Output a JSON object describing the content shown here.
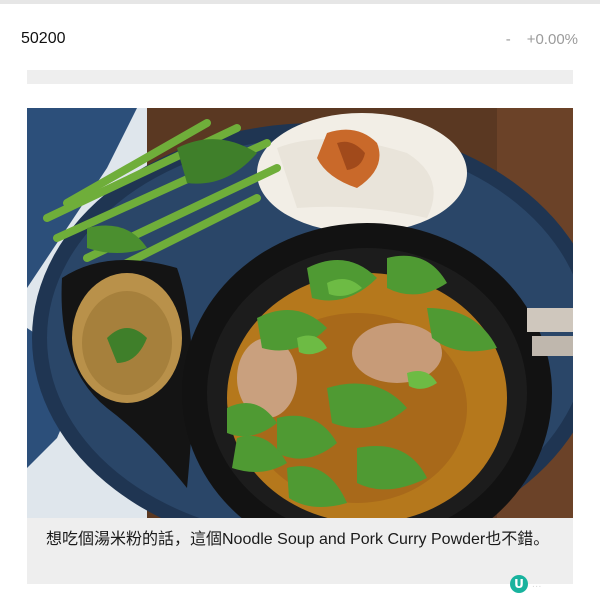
{
  "ticker": {
    "code": "50200",
    "change_dash": "-",
    "change_pct": "+0.00%"
  },
  "article_image": {
    "icon": "food-photo",
    "description_name": "noodle-soup-pork-curry-photo"
  },
  "caption": {
    "text": "想吃個湯米粉的話，這個Noodle Soup and Pork Curry Powder也不錯。"
  },
  "watermark": {
    "logo_letter": "U",
    "text": "..."
  },
  "colors": {
    "caption_bg": "#eeeeee",
    "muted_text": "#9b9b9b",
    "logo_teal": "#18b39e"
  }
}
